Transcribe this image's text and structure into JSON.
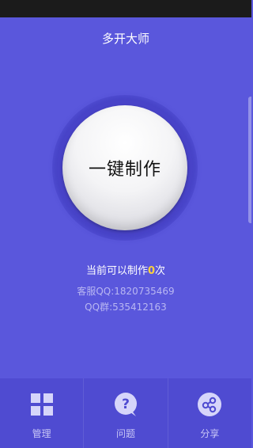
{
  "app": {
    "title": "多开大师"
  },
  "main": {
    "make_button_label": "一键制作",
    "count_prefix": "当前可以制作",
    "count_value": "0",
    "count_suffix": "次",
    "support_qq": "客服QQ:1820735469",
    "qq_group": "QQ群:535412163"
  },
  "tabs": [
    {
      "label": "管理",
      "icon": "grid-icon"
    },
    {
      "label": "问题",
      "icon": "question-icon"
    },
    {
      "label": "分享",
      "icon": "share-icon"
    }
  ],
  "colors": {
    "background": "#5a57dc",
    "tabbar": "#4f4bd1",
    "count_highlight": "#ffd23b",
    "contact_text": "#b9b7f2"
  }
}
